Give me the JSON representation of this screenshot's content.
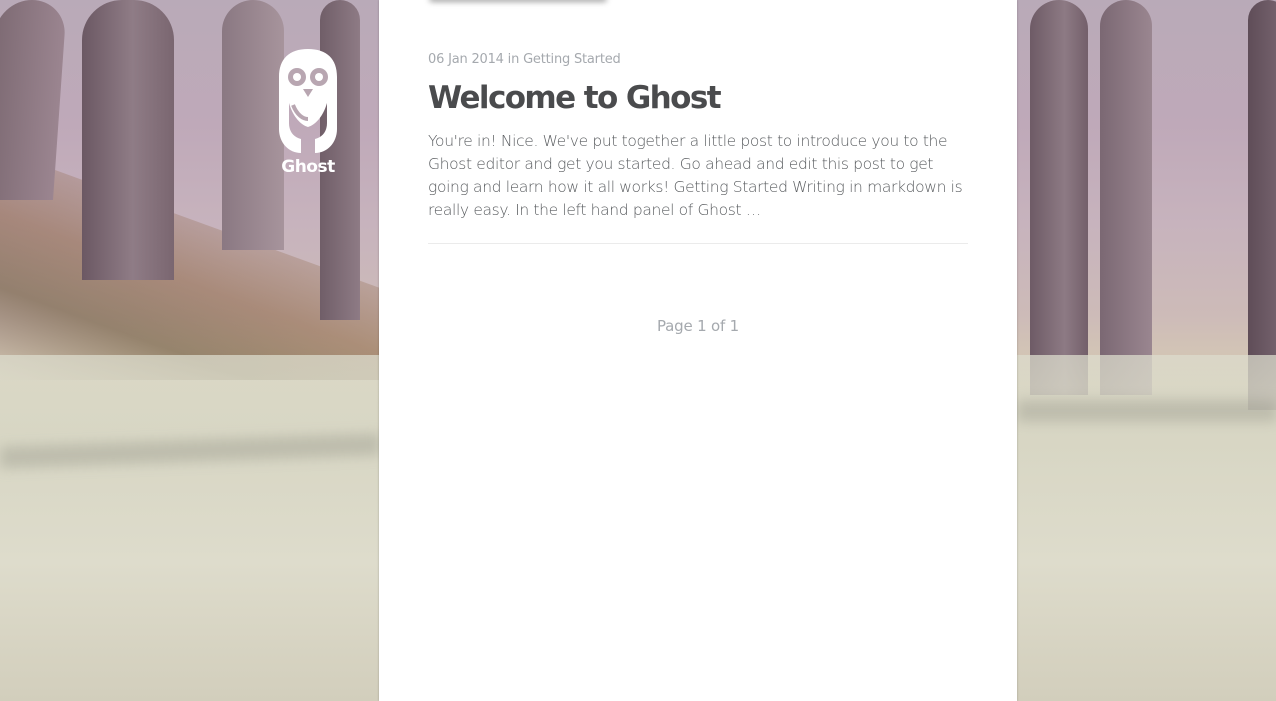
{
  "blog": {
    "name": "Ghost"
  },
  "post": {
    "date": "06 Jan 2014",
    "tag_prefix": "in",
    "tag": "Getting Started",
    "title": "Welcome to Ghost",
    "excerpt": "You're in! Nice. We've put together a little post to introduce you to the Ghost editor and get you started. Go ahead and edit this post to get going and learn how it all works! Getting Started Writing in markdown is really easy. In the left hand panel of Ghost …"
  },
  "pagination": {
    "label": "Page 1 of 1"
  },
  "colors": {
    "title": "#4a4b4d",
    "meta": "#a5a9ae",
    "body": "#5a5d60",
    "content_bg": "#ffffff"
  },
  "icons": {
    "logo": "ghost-owl-icon"
  }
}
